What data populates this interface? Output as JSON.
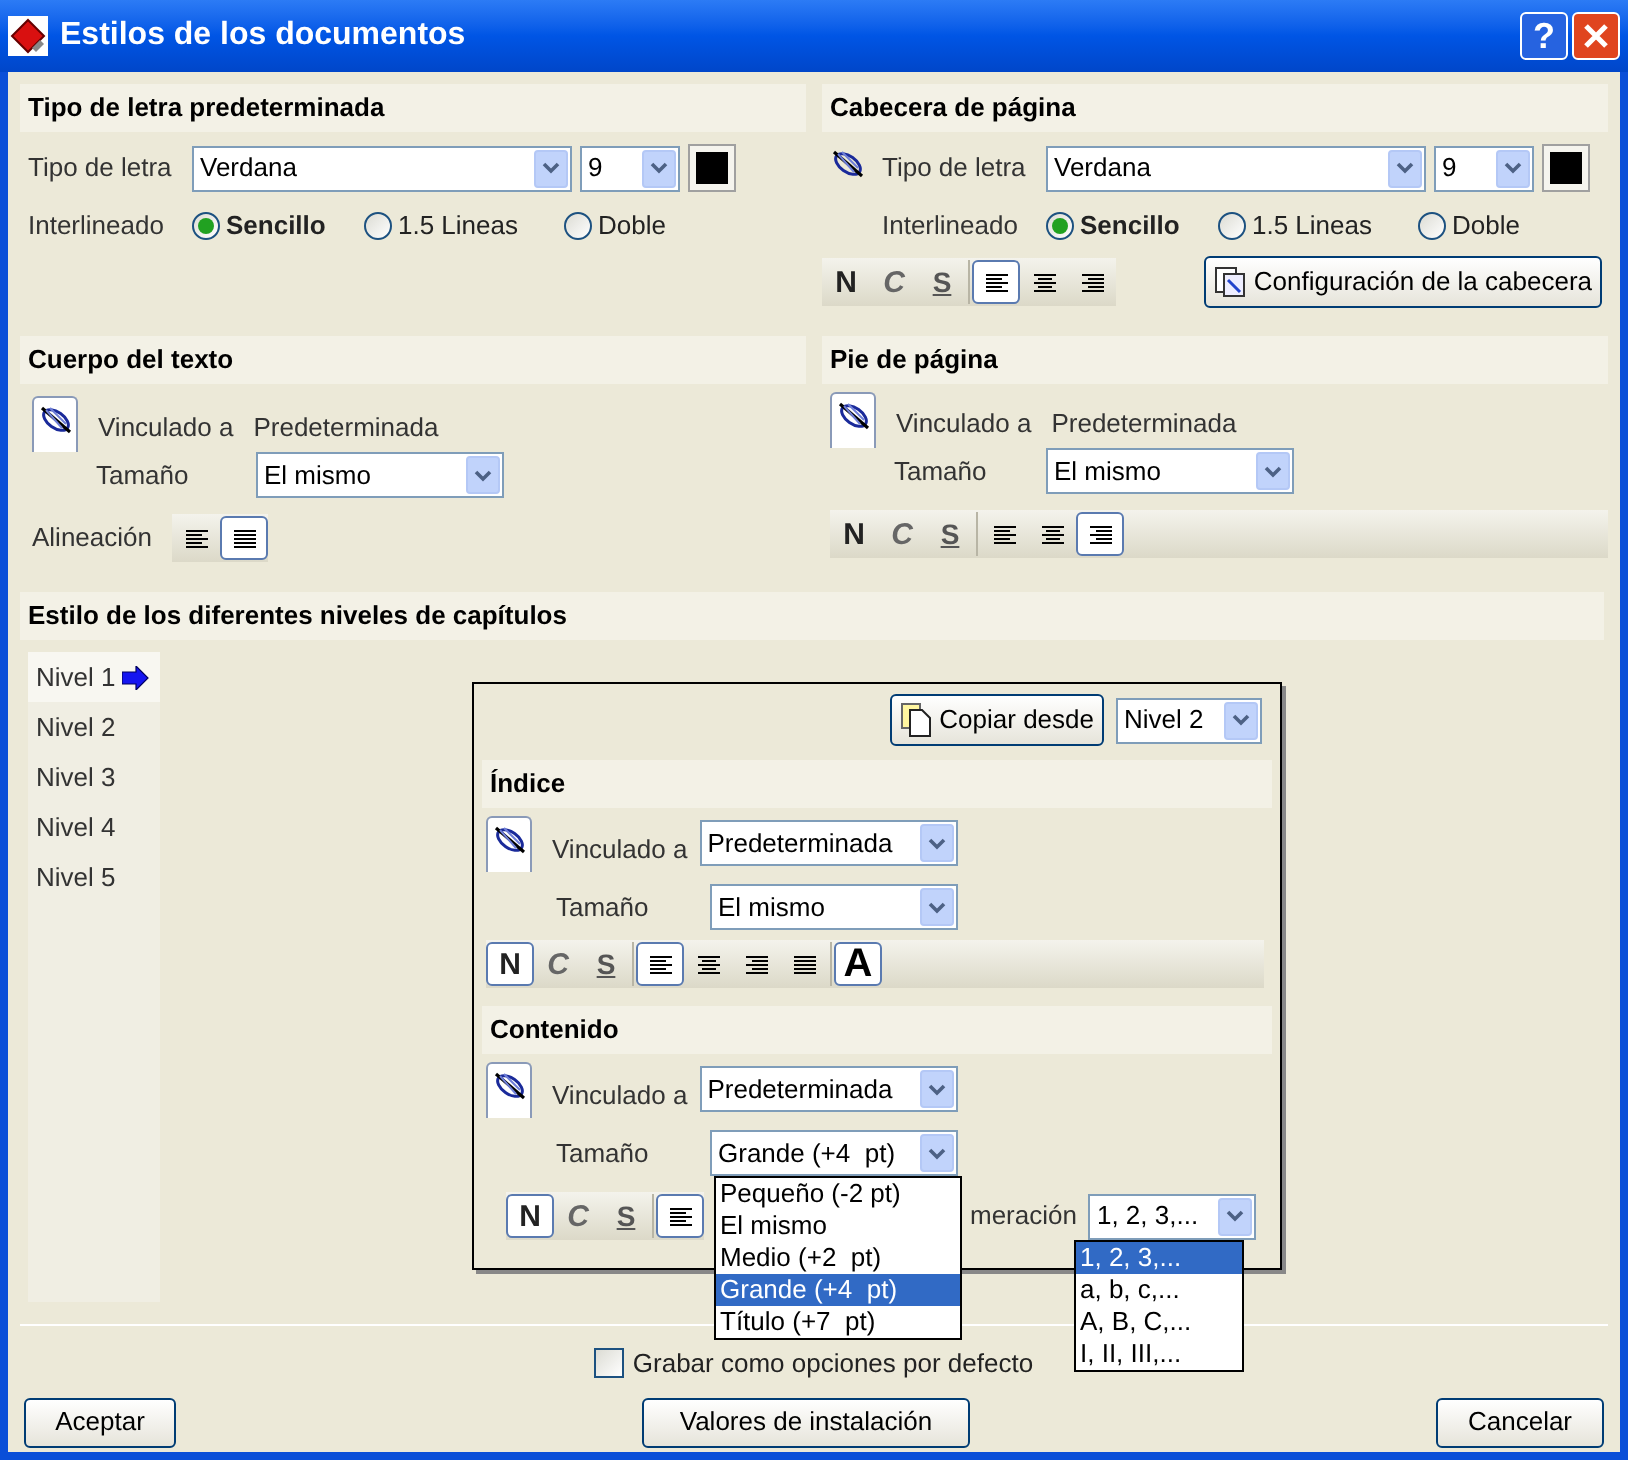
{
  "window": {
    "title": "Estilos de los documentos",
    "help": "?"
  },
  "default_font": {
    "title": "Tipo de letra predeterminada",
    "font_label": "Tipo de letra",
    "font": "Verdana",
    "size": "9",
    "spacing_label": "Interlineado",
    "spacing_options": [
      {
        "label": "Sencillo",
        "selected": true
      },
      {
        "label": "1.5 Lineas",
        "selected": false
      },
      {
        "label": "Doble",
        "selected": false
      }
    ]
  },
  "page_header": {
    "title": "Cabecera de página",
    "font_label": "Tipo de letra",
    "font": "Verdana",
    "size": "9",
    "spacing_label": "Interlineado",
    "spacing_options": [
      {
        "label": "Sencillo",
        "selected": true
      },
      {
        "label": "1.5 Lineas",
        "selected": false
      },
      {
        "label": "Doble",
        "selected": false
      }
    ],
    "toolbar": [
      {
        "kind": "bold",
        "label": "N",
        "selected": false
      },
      {
        "kind": "italic",
        "label": "C",
        "selected": false
      },
      {
        "kind": "underline",
        "label": "S",
        "selected": false
      },
      {
        "kind": "align-left",
        "selected": true
      },
      {
        "kind": "align-center",
        "selected": false
      },
      {
        "kind": "align-right",
        "selected": false
      }
    ],
    "config_button": "Configuración de la cabecera"
  },
  "body_text": {
    "title": "Cuerpo del texto",
    "linked_label": "Vinculado a",
    "linked_value": "Predeterminada",
    "size_label": "Tamaño",
    "size": "El mismo",
    "alignment_label": "Alineación",
    "alignment": [
      {
        "kind": "align-left",
        "selected": false
      },
      {
        "kind": "justify",
        "selected": true
      }
    ]
  },
  "page_footer": {
    "title": "Pie de página",
    "linked_label": "Vinculado a",
    "linked_value": "Predeterminada",
    "size_label": "Tamaño",
    "size": "El mismo",
    "toolbar": [
      {
        "kind": "bold",
        "label": "N",
        "selected": false
      },
      {
        "kind": "italic",
        "label": "C",
        "selected": false
      },
      {
        "kind": "underline",
        "label": "S",
        "selected": false
      },
      {
        "kind": "align-left",
        "selected": false
      },
      {
        "kind": "align-center",
        "selected": false
      },
      {
        "kind": "align-right",
        "selected": true
      }
    ]
  },
  "chapter_levels": {
    "title": "Estilo de los diferentes niveles de capítulos",
    "levels": [
      {
        "label": "Nivel 1",
        "selected": true
      },
      {
        "label": "Nivel 2",
        "selected": false
      },
      {
        "label": "Nivel 3",
        "selected": false
      },
      {
        "label": "Nivel 4",
        "selected": false
      },
      {
        "label": "Nivel 5",
        "selected": false
      }
    ],
    "copy_button": "Copiar desde",
    "copy_from": "Nivel 2",
    "index": {
      "title": "Índice",
      "linked_label": "Vinculado a",
      "linked_value": "Predeterminada",
      "size_label": "Tamaño",
      "size": "El mismo",
      "toolbar": [
        {
          "kind": "bold",
          "label": "N",
          "selected": true
        },
        {
          "kind": "italic",
          "label": "C",
          "selected": false
        },
        {
          "kind": "underline",
          "label": "S",
          "selected": false
        },
        {
          "kind": "align-left",
          "selected": true
        },
        {
          "kind": "align-center",
          "selected": false
        },
        {
          "kind": "align-right",
          "selected": false
        },
        {
          "kind": "justify",
          "selected": false
        },
        {
          "kind": "font",
          "label": "A",
          "selected": true
        }
      ]
    },
    "content": {
      "title": "Contenido",
      "linked_label": "Vinculado a",
      "linked_value": "Predeterminada",
      "size_label": "Tamaño",
      "size": "Grande (+4  pt)",
      "toolbar": [
        {
          "kind": "bold",
          "label": "N",
          "selected": true
        },
        {
          "kind": "italic",
          "label": "C",
          "selected": false
        },
        {
          "kind": "underline",
          "label": "S",
          "selected": false
        },
        {
          "kind": "align-left",
          "selected": true
        }
      ],
      "numbering_label": "meración",
      "numbering": "1, 2, 3,...",
      "size_options": [
        {
          "label": "Pequeño (-2 pt)",
          "selected": false
        },
        {
          "label": "El mismo",
          "selected": false
        },
        {
          "label": "Medio (+2  pt)",
          "selected": false
        },
        {
          "label": "Grande (+4  pt)",
          "selected": true
        },
        {
          "label": "Título (+7  pt)",
          "selected": false
        }
      ],
      "numbering_options": [
        {
          "label": "1, 2, 3,...",
          "selected": true
        },
        {
          "label": "a, b, c,...",
          "selected": false
        },
        {
          "label": "A, B, C,...",
          "selected": false
        },
        {
          "label": "I, II, III,...",
          "selected": false
        }
      ]
    }
  },
  "save_default": {
    "label": "Grabar como opciones por defecto",
    "checked": false
  },
  "buttons": [
    {
      "label": "Aceptar"
    },
    {
      "label": "Valores de instalación"
    },
    {
      "label": "Cancelar"
    }
  ]
}
